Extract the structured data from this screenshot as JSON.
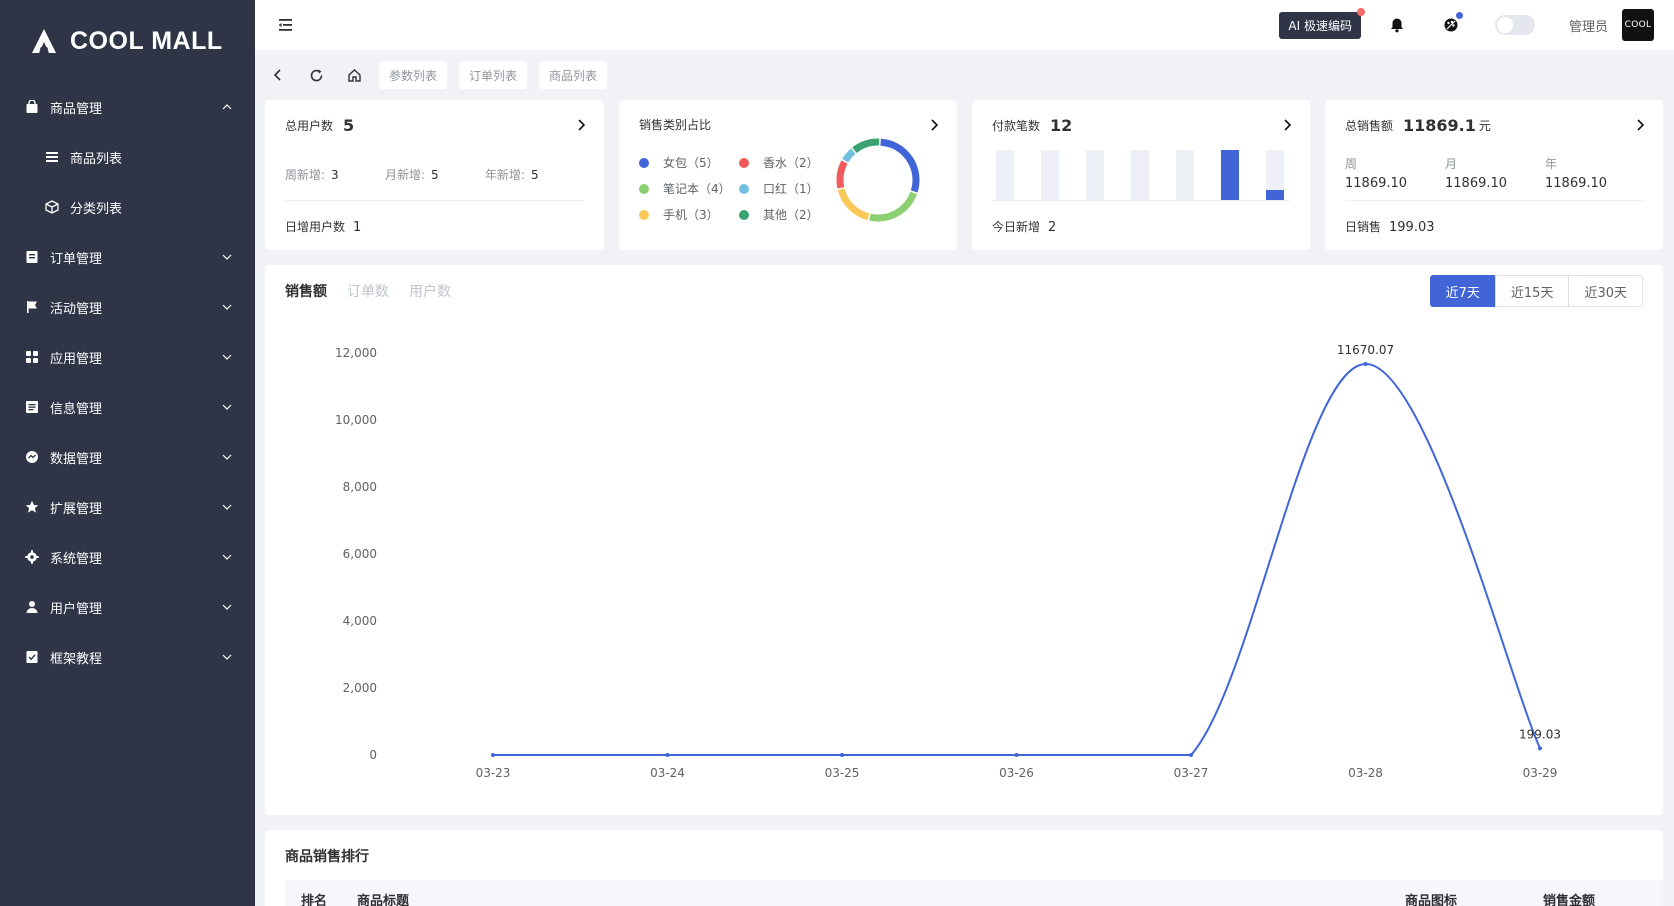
{
  "app": {
    "logo_text": "COOL MALL"
  },
  "sidebar": {
    "items": [
      {
        "label": "商品管理",
        "icon": "bag-icon",
        "expanded": true
      },
      {
        "label": "商品列表",
        "icon": "list-icon",
        "sub": true
      },
      {
        "label": "分类列表",
        "icon": "cube-icon",
        "sub": true
      },
      {
        "label": "订单管理",
        "icon": "order-icon"
      },
      {
        "label": "活动管理",
        "icon": "flag-icon"
      },
      {
        "label": "应用管理",
        "icon": "apps-icon"
      },
      {
        "label": "信息管理",
        "icon": "info-icon"
      },
      {
        "label": "数据管理",
        "icon": "data-icon"
      },
      {
        "label": "扩展管理",
        "icon": "star-icon"
      },
      {
        "label": "系统管理",
        "icon": "gear-icon"
      },
      {
        "label": "用户管理",
        "icon": "user-icon"
      },
      {
        "label": "框架教程",
        "icon": "book-icon"
      }
    ]
  },
  "topbar": {
    "ai_label": "AI 极速编码",
    "username": "管理员",
    "avatar_text": "COOL"
  },
  "tabs": [
    "参数列表",
    "订单列表",
    "商品列表"
  ],
  "cards": {
    "users": {
      "title": "总用户数",
      "value": "5",
      "week_label": "周新增:",
      "week_value": "3",
      "month_label": "月新增:",
      "month_value": "5",
      "year_label": "年新增:",
      "year_value": "5",
      "foot_label": "日增用户数",
      "foot_value": "1"
    },
    "category": {
      "title": "销售类别占比",
      "legend": [
        {
          "name": "女包（5）",
          "color": "#4165d7",
          "value": 5
        },
        {
          "name": "香水（2）",
          "color": "#f15b5b",
          "value": 2
        },
        {
          "name": "笔记本（4）",
          "color": "#8dd071",
          "value": 4
        },
        {
          "name": "口红（1）",
          "color": "#6fc0e1",
          "value": 1
        },
        {
          "name": "手机（3）",
          "color": "#fac858",
          "value": 3
        },
        {
          "name": "其他（2）",
          "color": "#3ba272",
          "value": 2
        }
      ]
    },
    "payments": {
      "title": "付款笔数",
      "value": "12",
      "bars": [
        0,
        0,
        0,
        0,
        0,
        1,
        0.2
      ],
      "foot_label": "今日新增",
      "foot_value": "2"
    },
    "sales": {
      "title": "总销售额",
      "value": "11869.1",
      "unit": "元",
      "week_label": "周",
      "week_value": "11869.10",
      "month_label": "月",
      "month_value": "11869.10",
      "year_label": "年",
      "year_value": "11869.10",
      "foot_label": "日销售",
      "foot_value": "199.03"
    }
  },
  "chart_tabs": [
    "销售额",
    "订单数",
    "用户数"
  ],
  "range_buttons": [
    "近7天",
    "近15天",
    "近30天"
  ],
  "chart_data": {
    "type": "line",
    "categories": [
      "03-23",
      "03-24",
      "03-25",
      "03-26",
      "03-27",
      "03-28",
      "03-29"
    ],
    "series": [
      {
        "values": [
          0,
          0,
          0,
          0,
          0,
          11670.07,
          199.03
        ]
      }
    ],
    "yticks": [
      "0",
      "2,000",
      "4,000",
      "6,000",
      "8,000",
      "10,000",
      "12,000"
    ],
    "ylim": [
      0,
      12000
    ],
    "data_labels": [
      "11670.07",
      "199.03"
    ],
    "color": "#4165d7",
    "smooth": true
  },
  "rank": {
    "title": "商品销售排行",
    "headers": [
      "排名",
      "商品标题",
      "商品图标",
      "销售金额"
    ]
  }
}
